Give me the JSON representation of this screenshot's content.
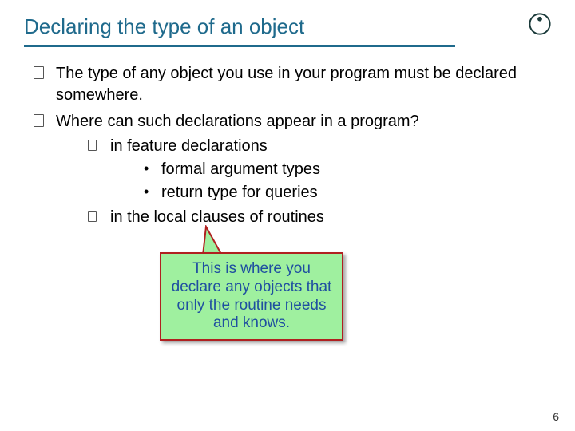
{
  "title": "Declaring the type of an object",
  "bullets": {
    "a": "The type of any object you use in your program must be declared somewhere.",
    "b": "Where can such declarations appear in a program?",
    "b1": "in feature declarations",
    "b1a": "formal argument types",
    "b1b": "return type for queries",
    "b2": "in the local clauses of routines"
  },
  "callout": "This is where you declare any objects that only the routine needs and knows.",
  "page_number": "6",
  "colors": {
    "title": "#1f6a8c",
    "callout_bg": "#9ff09f",
    "callout_border": "#b02020",
    "callout_text": "#1f4fa0"
  }
}
